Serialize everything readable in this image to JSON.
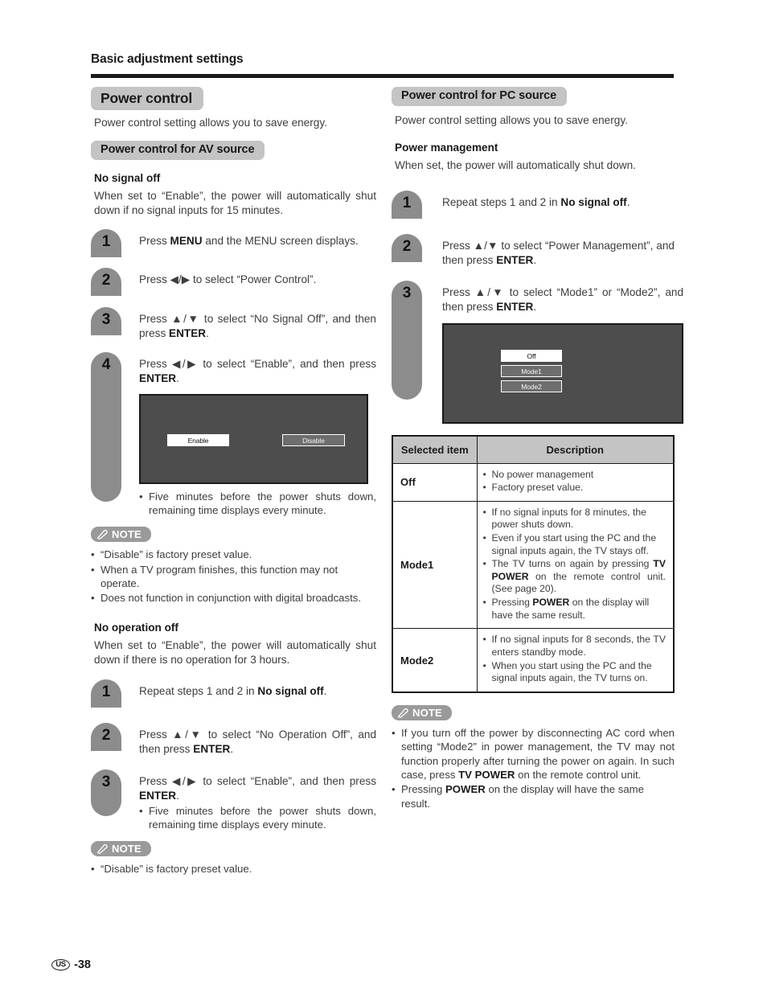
{
  "header": {
    "chapter_title": "Basic adjustment settings"
  },
  "left": {
    "h1": "Power control",
    "h1_intro": "Power control setting allows you to save energy.",
    "h2": "Power control for AV source",
    "section1": {
      "sub_head": "No signal off",
      "body": "When set to “Enable”, the power will automatically shut down if no signal inputs for 15 minutes.",
      "steps": [
        {
          "num": "1",
          "text_html": "Press <b>MENU</b> and the MENU screen displays."
        },
        {
          "num": "2",
          "text_html": "Press ◀/▶ to select “Power Control”."
        },
        {
          "num": "3",
          "text_html": "Press ▲/▼ to select “No Signal Off”, and then press <b>ENTER</b>."
        },
        {
          "num": "4",
          "text_html": "Press ◀/▶ to select “Enable”, and then press <b>ENTER</b>."
        }
      ],
      "screen": {
        "buttons": [
          {
            "label": "Enable",
            "state": "selected"
          },
          {
            "label": "Disable",
            "state": "unselected"
          }
        ]
      },
      "screen_bullet": "Five minutes before the power shuts down, remaining time displays every minute.",
      "note_label": "NOTE",
      "notes": [
        "“Disable” is factory preset value.",
        "When a TV program finishes, this function may not operate.",
        "Does not function in conjunction with digital broadcasts."
      ]
    },
    "section2": {
      "sub_head": "No operation off",
      "body": "When set to “Enable”, the power will automatically shut down if there is no operation for 3 hours.",
      "steps": [
        {
          "num": "1",
          "text_html": "Repeat steps 1 and 2 in <b>No signal off</b>."
        },
        {
          "num": "2",
          "text_html": "Press ▲/▼ to select “No Operation Off”, and then press <b>ENTER</b>."
        },
        {
          "num": "3",
          "text_html": "Press ◀/▶ to select “Enable”, and then press <b>ENTER</b>."
        }
      ],
      "step3_bullet": "Five minutes before the power shuts down, remaining time displays every minute.",
      "note_label": "NOTE",
      "notes": [
        "“Disable” is factory preset value."
      ]
    }
  },
  "right": {
    "h2": "Power control for PC source",
    "h2_intro": "Power control setting allows you to save energy.",
    "sub_head": "Power management",
    "body": "When set, the power will automatically shut down.",
    "steps": [
      {
        "num": "1",
        "text_html": "Repeat steps 1 and 2 in <b>No signal off</b>."
      },
      {
        "num": "2",
        "text_html": "Press ▲/▼ to select “Power Management”, and then press <b>ENTER</b>."
      },
      {
        "num": "3",
        "text_html": "Press ▲/▼ to select “Mode1” or “Mode2”, and then press <b>ENTER</b>."
      }
    ],
    "screen": {
      "buttons": [
        {
          "label": "Off",
          "state": "selected"
        },
        {
          "label": "Mode1",
          "state": "unselected"
        },
        {
          "label": "Mode2",
          "state": "unselected"
        }
      ]
    },
    "table": {
      "headers": [
        "Selected item",
        "Description"
      ],
      "rows": [
        {
          "item": "Off",
          "desc_html": [
            "No power management",
            "Factory preset value."
          ]
        },
        {
          "item": "Mode1",
          "desc_html": [
            "If no signal inputs for 8 minutes, the power shuts down.",
            "Even if you start using the PC and the signal inputs again, the TV stays off.",
            "The TV turns on again by pressing <b>TV POWER</b> on the remote control unit. (See page 20).",
            "Pressing <b>POWER</b> on the display will have the same result."
          ]
        },
        {
          "item": "Mode2",
          "desc_html": [
            "If no signal inputs for 8 seconds, the TV enters standby mode.",
            "When you start using the PC and the signal inputs again, the TV turns on."
          ]
        }
      ]
    },
    "note_label": "NOTE",
    "notes_html": [
      "If you turn off the power by disconnecting AC cord when setting “Mode2” in power management, the TV may not function properly after turning the power on again. In such case, press <b>TV POWER</b> on the remote control unit.",
      "Pressing <b>POWER</b> on the display will have the same result."
    ]
  },
  "footer": {
    "region": "US",
    "page": "-38"
  },
  "colors": {
    "pill_gray": "#c4c4c4",
    "badge_gray": "#8c8c8c",
    "note_gray": "#9a9a9a",
    "screen_gray": "#4d4d4d",
    "rule_black": "#1a1a1a"
  }
}
